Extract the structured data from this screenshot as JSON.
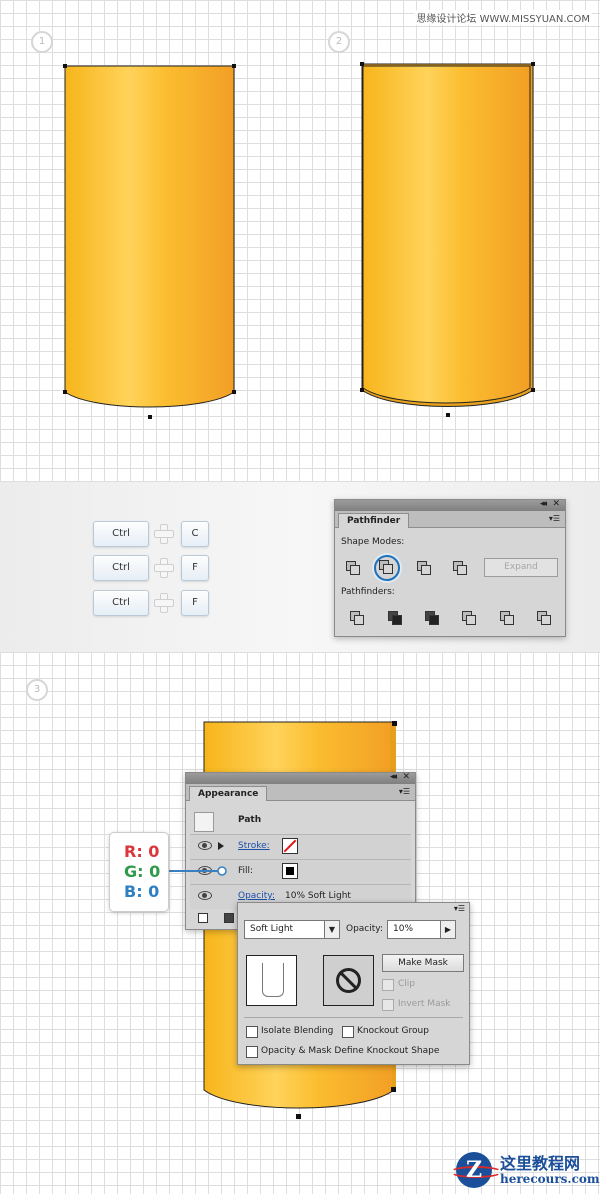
{
  "watermark": "思缘设计论坛 WWW.MISSYUAN.COM",
  "steps": [
    "1",
    "2",
    "3"
  ],
  "shortcuts": [
    {
      "modifier": "Ctrl",
      "key": "C"
    },
    {
      "modifier": "Ctrl",
      "key": "F"
    },
    {
      "modifier": "Ctrl",
      "key": "F"
    }
  ],
  "pathfinder": {
    "tab": "Pathfinder",
    "shape_modes_label": "Shape Modes:",
    "pathfinders_label": "Pathfinders:",
    "expand_label": "Expand"
  },
  "appearance": {
    "tab": "Appearance",
    "path_label": "Path",
    "stroke_label": "Stroke:",
    "fill_label": "Fill:",
    "opacity_label": "Opacity:",
    "opacity_value": "10% Soft Light"
  },
  "transparency": {
    "blend_mode": "Soft Light",
    "opacity_label": "Opacity:",
    "opacity_value": "10%",
    "make_mask": "Make Mask",
    "clip": "Clip",
    "invert_mask": "Invert Mask",
    "isolate_blending": "Isolate Blending",
    "knockout_group": "Knockout Group",
    "opacity_mask_define": "Opacity & Mask Define Knockout Shape"
  },
  "rgb": {
    "r": "R: 0",
    "g": "G: 0",
    "b": "B: 0"
  },
  "colors": {
    "r": "#d9373b",
    "g": "#2e9a4a",
    "b": "#2f7fc3"
  },
  "logo": {
    "zh": "这里教程网",
    "en": "herecours.com"
  }
}
